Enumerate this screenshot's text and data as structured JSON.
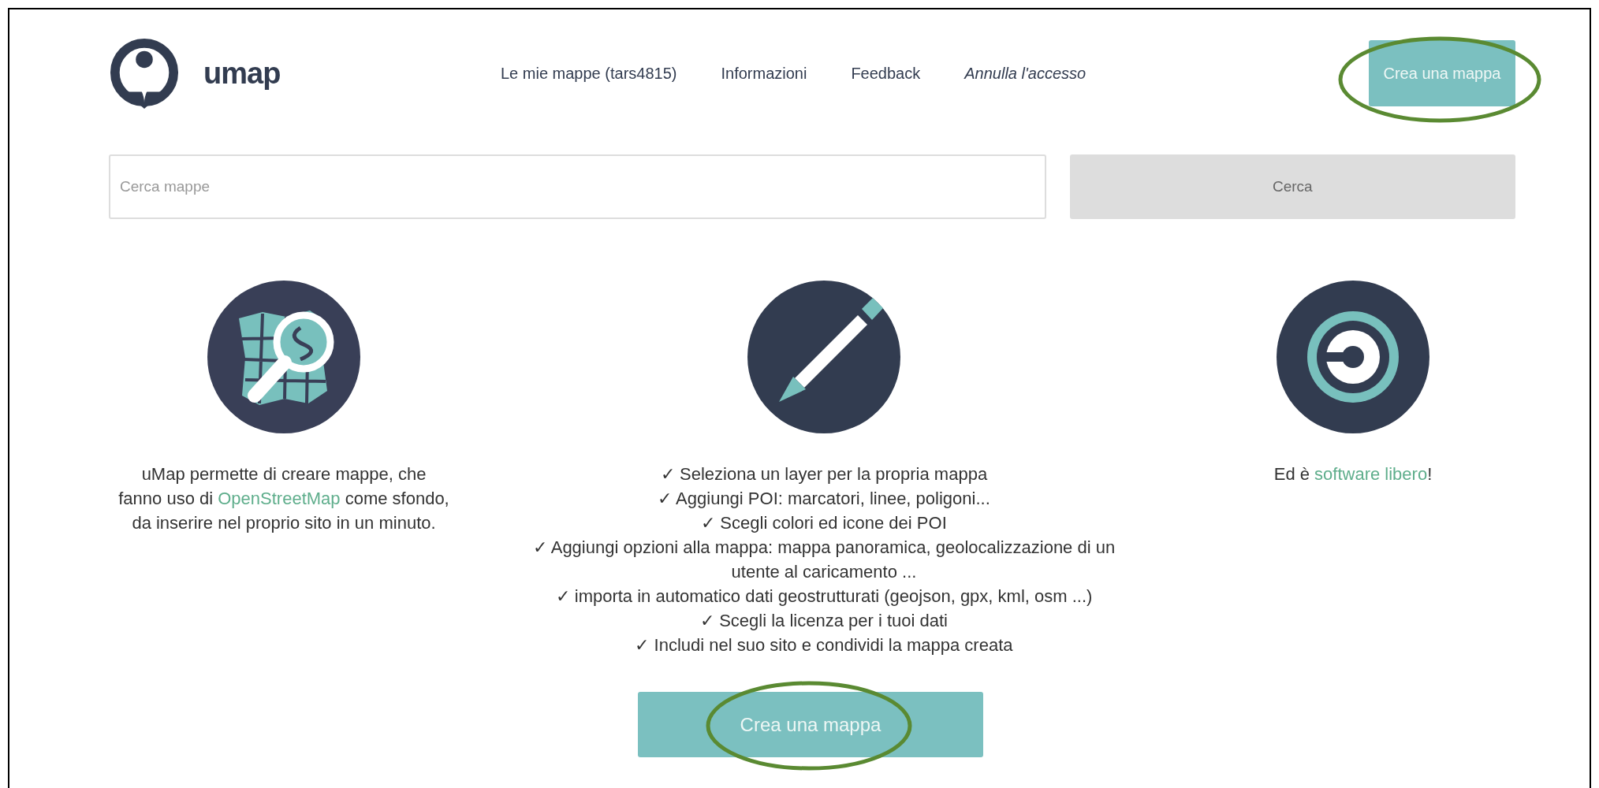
{
  "header": {
    "logo_text": "umap",
    "nav": [
      {
        "label": "Le mie mappe (tars4815)",
        "kind": "link"
      },
      {
        "label": "Informazioni",
        "kind": "link"
      },
      {
        "label": "Feedback",
        "kind": "link"
      },
      {
        "label": "Annulla l'accesso",
        "kind": "logout"
      }
    ],
    "create_button": {
      "label": "Crea una mappa",
      "circled": true
    }
  },
  "search": {
    "placeholder": "Cerca mappe",
    "button": "Cerca"
  },
  "columns": [
    {
      "paragraph": [
        {
          "text": "uMap permette di creare mappe, che fanno uso di "
        },
        {
          "text": "OpenStreetMap",
          "kind": "link"
        },
        {
          "text": " come sfondo, da inserire nel proprio sito in un minuto."
        }
      ]
    },
    {
      "items": [
        "✓ Seleziona un layer per la propria mappa",
        "✓ Aggiungi POI: marcatori, linee, poligoni...",
        "✓ Scegli colori ed icone dei POI",
        "✓ Aggiungi opzioni alla mappa: mappa panoramica, geolocalizzazione di un utente al caricamento ...",
        "✓ importa in automatico dati geostrutturati (geojson, gpx, kml, osm ...)",
        "✓ Scegli la licenza per i tuoi dati",
        "✓ Includi nel suo sito e condividi la mappa creata"
      ]
    },
    {
      "paragraph": [
        {
          "text": "Ed è "
        },
        {
          "text": "software libero",
          "kind": "link"
        },
        {
          "text": "!"
        }
      ]
    }
  ],
  "bottom_button": {
    "label": "Crea una mappa",
    "circled": true
  }
}
